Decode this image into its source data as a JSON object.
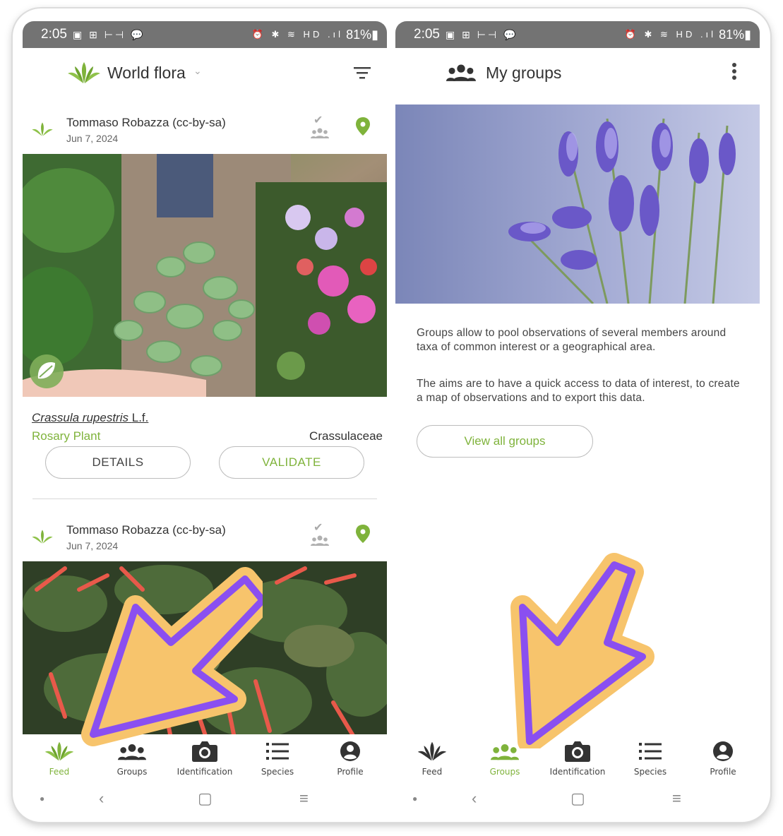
{
  "status_bar": {
    "time": "2:05",
    "left_icons": "▣ ⊞ ⊢⊣ 💬",
    "right_icons": "⏰ ✱ ≋ HD .ıl",
    "battery": "81%▮"
  },
  "left_screen": {
    "app_title": "World flora",
    "observations": [
      {
        "author": "Tommaso Robazza (cc-by-sa)",
        "date": "Jun 7, 2024"
      },
      {
        "author": "Tommaso Robazza (cc-by-sa)",
        "date": "Jun 7, 2024"
      }
    ],
    "species": {
      "scientific_name": "Crassula rupestris",
      "authority": "L.f.",
      "common_name": "Rosary Plant",
      "family": "Crassulaceae"
    },
    "buttons": {
      "details": "DETAILS",
      "validate": "VALIDATE"
    }
  },
  "right_screen": {
    "title": "My groups",
    "paragraph_1": "Groups allow to pool observations of several members around taxa of common interest or a geographical area.",
    "paragraph_2": "The aims are to have a quick access to data of interest, to create a map of observations and to export this data.",
    "view_all_label": "View all groups"
  },
  "bottom_nav": {
    "items": [
      "Feed",
      "Groups",
      "Identification",
      "Species",
      "Profile"
    ]
  },
  "colors": {
    "accent": "#7fb33b",
    "status_bar": "#737373",
    "arrow_fill": "#f7c46c",
    "arrow_outline": "#8a4ff0"
  },
  "icons": [
    "leaf-logo-icon",
    "filter-icon",
    "check-icon",
    "group-icon",
    "location-pin-icon",
    "more-vert-icon",
    "camera-icon",
    "list-icon",
    "account-icon"
  ]
}
